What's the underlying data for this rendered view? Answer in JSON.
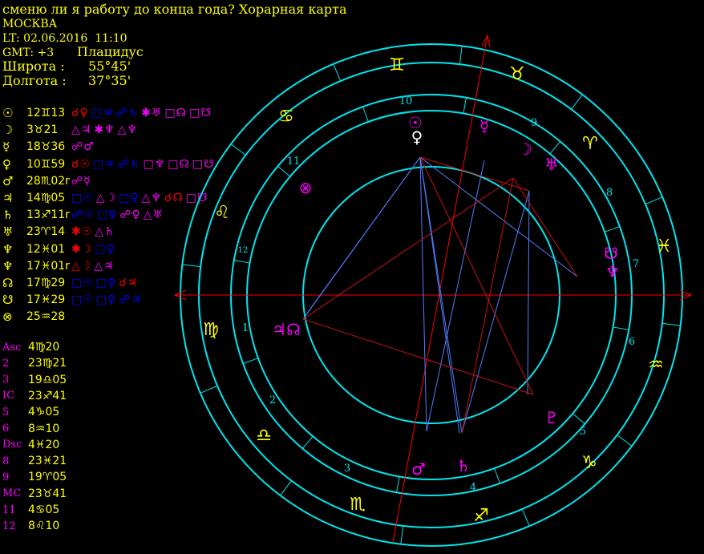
{
  "header": {
    "title": "сменю ли я работу до конца года? Хорарная карта",
    "city": "МОСКВА",
    "lt": "LT: 02.06.2016  11:10",
    "gmt": "GMT: +3",
    "house_system": "Плацидус",
    "lat_label": "Широта :",
    "lat_value": "55°45'",
    "lon_label": "Долгота :",
    "lon_value": "37°35'"
  },
  "planets": [
    {
      "sym": "☉",
      "pos": "12♊13",
      "aspects": [
        [
          "☌♀",
          "#ff0000"
        ],
        [
          "□♃",
          "#0000ff"
        ],
        [
          "☍♄",
          "#0000ff"
        ],
        [
          "✱♅",
          "#ff00ff"
        ],
        [
          "□☊",
          "#ff00ff"
        ],
        [
          "□☋",
          "#ff00ff"
        ]
      ]
    },
    {
      "sym": "☽",
      "pos": "3♉21",
      "aspects": [
        [
          "△♃",
          "#ff00ff"
        ],
        [
          "✱♆",
          "#ff00ff"
        ],
        [
          "△♆",
          "#ff00ff"
        ]
      ]
    },
    {
      "sym": "☿",
      "pos": "18♉36",
      "aspects": [
        [
          "☍♂",
          "#ff00ff"
        ]
      ]
    },
    {
      "sym": "♀",
      "pos": "10♊59",
      "aspects": [
        [
          "☌☉",
          "#ff0000"
        ],
        [
          "□♃",
          "#0000ff"
        ],
        [
          "☍♄",
          "#0000ff"
        ],
        [
          "□♆",
          "#ff00ff"
        ],
        [
          "□☊",
          "#ff00ff"
        ],
        [
          "□☋",
          "#ff00ff"
        ]
      ]
    },
    {
      "sym": "♂",
      "pos": "28♏02r",
      "aspects": [
        [
          "☍☿",
          "#ff00ff"
        ]
      ]
    },
    {
      "sym": "♃",
      "pos": "14♍05",
      "aspects": [
        [
          "□☉",
          "#0000ff"
        ],
        [
          "△☽",
          "#ff00ff"
        ],
        [
          "□♀",
          "#0000ff"
        ],
        [
          "△♆",
          "#ff00ff"
        ],
        [
          "☌☊",
          "#ff0000"
        ],
        [
          "□☋",
          "#ff00ff"
        ]
      ]
    },
    {
      "sym": "♄",
      "pos": "13♐11r",
      "aspects": [
        [
          "☍☉",
          "#0000ff"
        ],
        [
          "□♀",
          "#0000ff"
        ],
        [
          "☍♀",
          "#ff00ff"
        ],
        [
          "△♅",
          "#ff00ff"
        ]
      ]
    },
    {
      "sym": "♅",
      "pos": "23♈14",
      "aspects": [
        [
          "✱☉",
          "#ff0000"
        ],
        [
          "△♄",
          "#ff00ff"
        ]
      ]
    },
    {
      "sym": "♆",
      "pos": "12♓01",
      "aspects": [
        [
          "✱☽",
          "#ff0000"
        ],
        [
          "□♀",
          "#0000ff"
        ]
      ]
    },
    {
      "sym": "♆",
      "pos": "17♓01r",
      "aspects": [
        [
          "△☽",
          "#ff0000"
        ],
        [
          "△♃",
          "#ff00ff"
        ]
      ]
    },
    {
      "sym": "☊",
      "pos": "17♍29",
      "aspects": [
        [
          "□☉",
          "#0000ff"
        ],
        [
          "□♀",
          "#0000ff"
        ],
        [
          "☌♃",
          "#ff0000"
        ]
      ]
    },
    {
      "sym": "☋",
      "pos": "17♓29",
      "aspects": [
        [
          "□☉",
          "#0000ff"
        ],
        [
          "□♀",
          "#0000ff"
        ],
        [
          "☍♃",
          "#0000ff"
        ]
      ]
    },
    {
      "sym": "⊗",
      "pos": "25♒28",
      "aspects": []
    }
  ],
  "cusps": [
    {
      "label": "Asc",
      "value": "4♍20"
    },
    {
      "label": "2",
      "value": "23♍21"
    },
    {
      "label": "3",
      "value": "19♎05"
    },
    {
      "label": "IC",
      "value": "23♐41"
    },
    {
      "label": "5",
      "value": "4♑05"
    },
    {
      "label": "6",
      "value": "8♒10"
    },
    {
      "label": "Dsc",
      "value": "4♓20"
    },
    {
      "label": "8",
      "value": "23♓21"
    },
    {
      "label": "9",
      "value": "19♈05"
    },
    {
      "label": "MC",
      "value": "23♉41"
    },
    {
      "label": "11",
      "value": "4♋05"
    },
    {
      "label": "12",
      "value": "8♌10"
    }
  ],
  "wheel": {
    "signs": [
      {
        "sym": "♉",
        "angle": "taurus"
      },
      {
        "sym": "♊",
        "angle": "gemini"
      }
    ],
    "sign_glyphs": [
      "♊",
      "♉",
      "♈",
      "♓",
      "♒",
      "♑",
      "♐",
      "♏",
      "♎",
      "♍",
      "♌",
      "♋"
    ],
    "house_numbers": [
      "1",
      "2",
      "3",
      "4",
      "5",
      "6",
      "7",
      "8",
      "9",
      "10",
      "11",
      "12"
    ],
    "planet_glyphs": [
      "☉",
      "♀",
      "☿",
      "☽",
      "♅",
      "☋",
      "♆",
      "♃☊",
      "⊗",
      "♂",
      "♄",
      "♇"
    ]
  }
}
